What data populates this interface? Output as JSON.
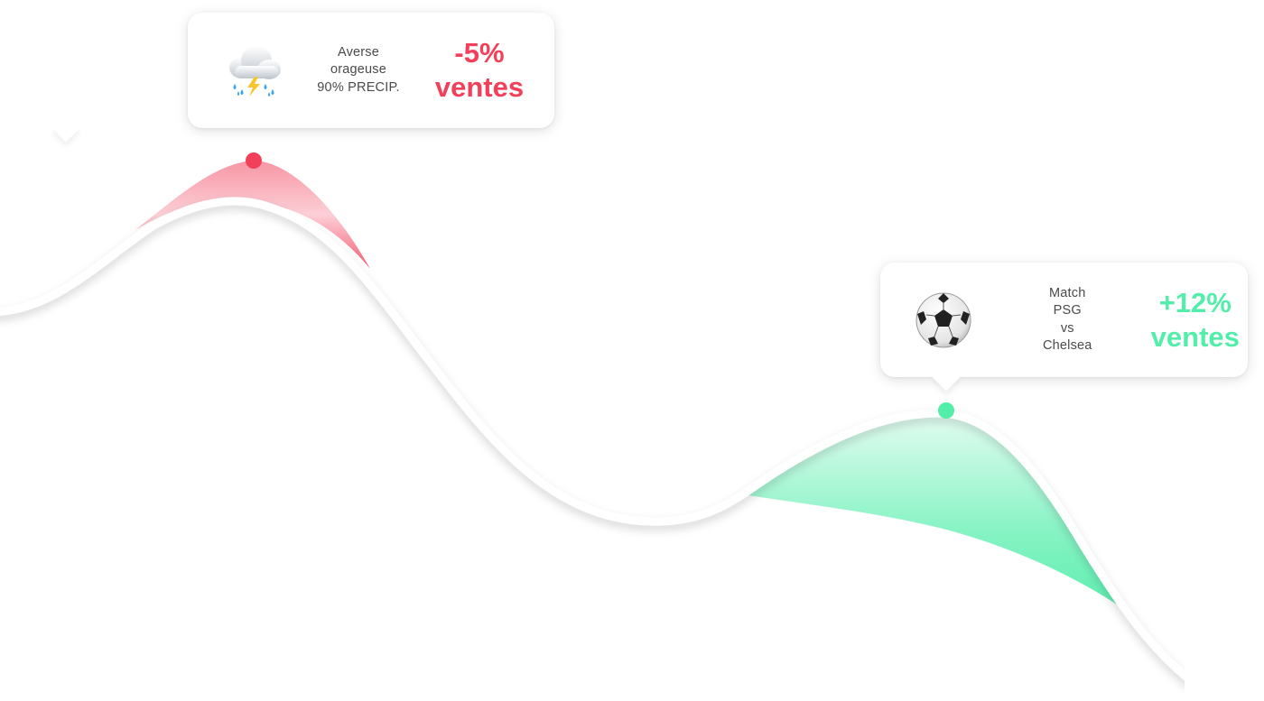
{
  "colors": {
    "negative": "#f2405a",
    "positive": "#52eeaa",
    "line": "#ffffff"
  },
  "events": [
    {
      "icon": "thunderstorm-cloud-icon",
      "description": [
        "Averse",
        "orageuse",
        "90% PRECIP."
      ],
      "change": "-5%",
      "unit": "ventes"
    },
    {
      "icon": "soccer-ball-icon",
      "description": [
        "Match",
        "PSG",
        "vs",
        "Chelsea"
      ],
      "change": "+12%",
      "unit": "ventes"
    }
  ]
}
